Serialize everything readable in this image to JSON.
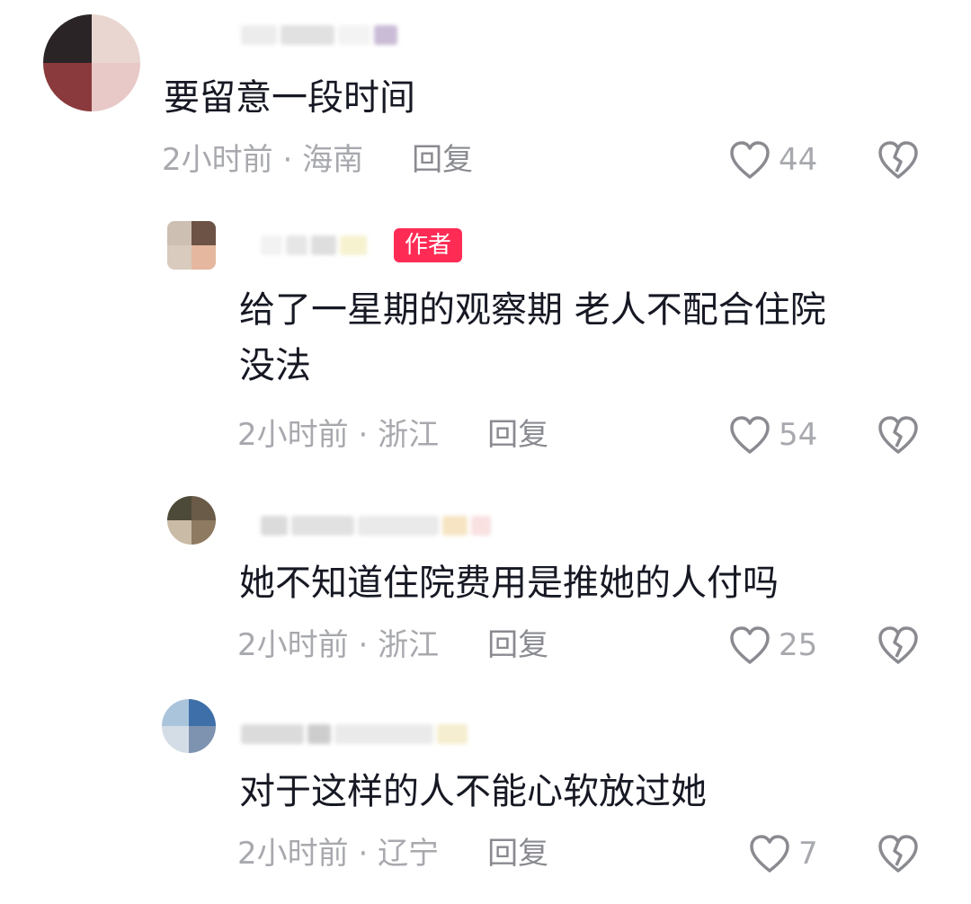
{
  "labels": {
    "reply": "回复",
    "author_tag": "作者"
  },
  "comments": [
    {
      "text": "要留意一段时间",
      "time": "2小时前",
      "location": "海南",
      "likes": "44"
    },
    {
      "text": "给了一星期的观察期 老人不配合住院\n没法",
      "time": "2小时前",
      "location": "浙江",
      "likes": "54"
    },
    {
      "text": "她不知道住院费用是推她的人付吗",
      "time": "2小时前",
      "location": "浙江",
      "likes": "25"
    },
    {
      "text": "对于这样的人不能心软放过她",
      "time": "2小时前",
      "location": "辽宁",
      "likes": "7"
    }
  ],
  "icons": {
    "like": "heart-outline-icon",
    "dislike": "broken-heart-icon"
  },
  "colors": {
    "author_tag": "#fe2c55",
    "meta": "#a8a9ae",
    "text": "#161823"
  }
}
